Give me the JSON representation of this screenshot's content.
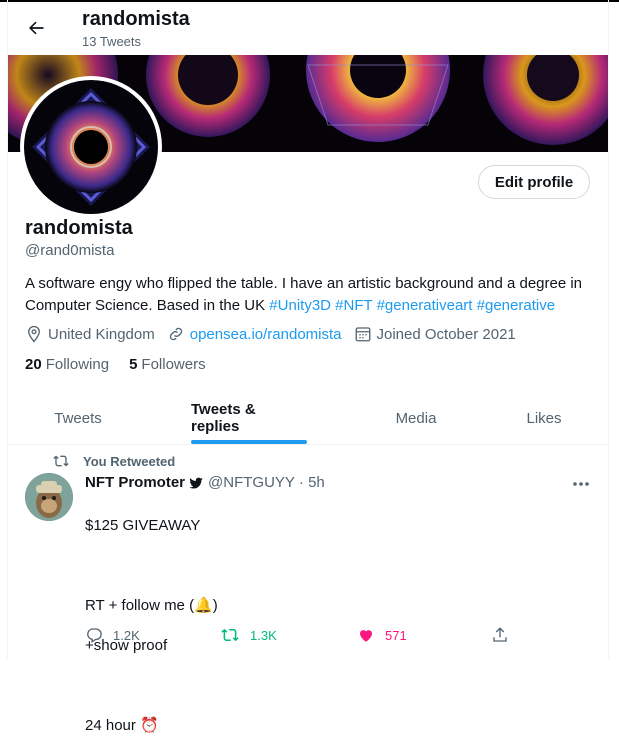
{
  "header": {
    "name": "randomista",
    "tweet_count": "13 Tweets"
  },
  "profile": {
    "edit_button": "Edit profile",
    "name": "randomista",
    "handle": "@rand0mista",
    "bio_text": "A software engy who flipped the table. I have an artistic background and a degree in Computer Science. Based in the UK ",
    "hashtags": [
      "#Unity3D",
      "#NFT",
      "#generativeart",
      "#generative"
    ],
    "location": "United Kingdom",
    "website": "opensea.io/randomista",
    "joined": "Joined October 2021",
    "following_count": "20",
    "following_label": "Following",
    "followers_count": "5",
    "followers_label": "Followers"
  },
  "tabs": [
    {
      "label": "Tweets",
      "active": false
    },
    {
      "label": "Tweets & replies",
      "active": true
    },
    {
      "label": "Media",
      "active": false
    },
    {
      "label": "Likes",
      "active": false
    }
  ],
  "tweet": {
    "retweet_note": "You Retweeted",
    "author_name": "NFT Promoter",
    "author_handle": "@NFTGUYY",
    "time": "· 5h",
    "body_line1": "$125 GIVEAWAY",
    "body_line2": "RT + follow me (🔔)",
    "body_line3": "+show proof",
    "body_line4": "24 hour ⏰",
    "replies": "1.2K",
    "retweets": "1.3K",
    "likes": "571"
  },
  "colors": {
    "accent": "#1d9bf0",
    "retweet": "#00ba7c",
    "like": "#f91880"
  }
}
